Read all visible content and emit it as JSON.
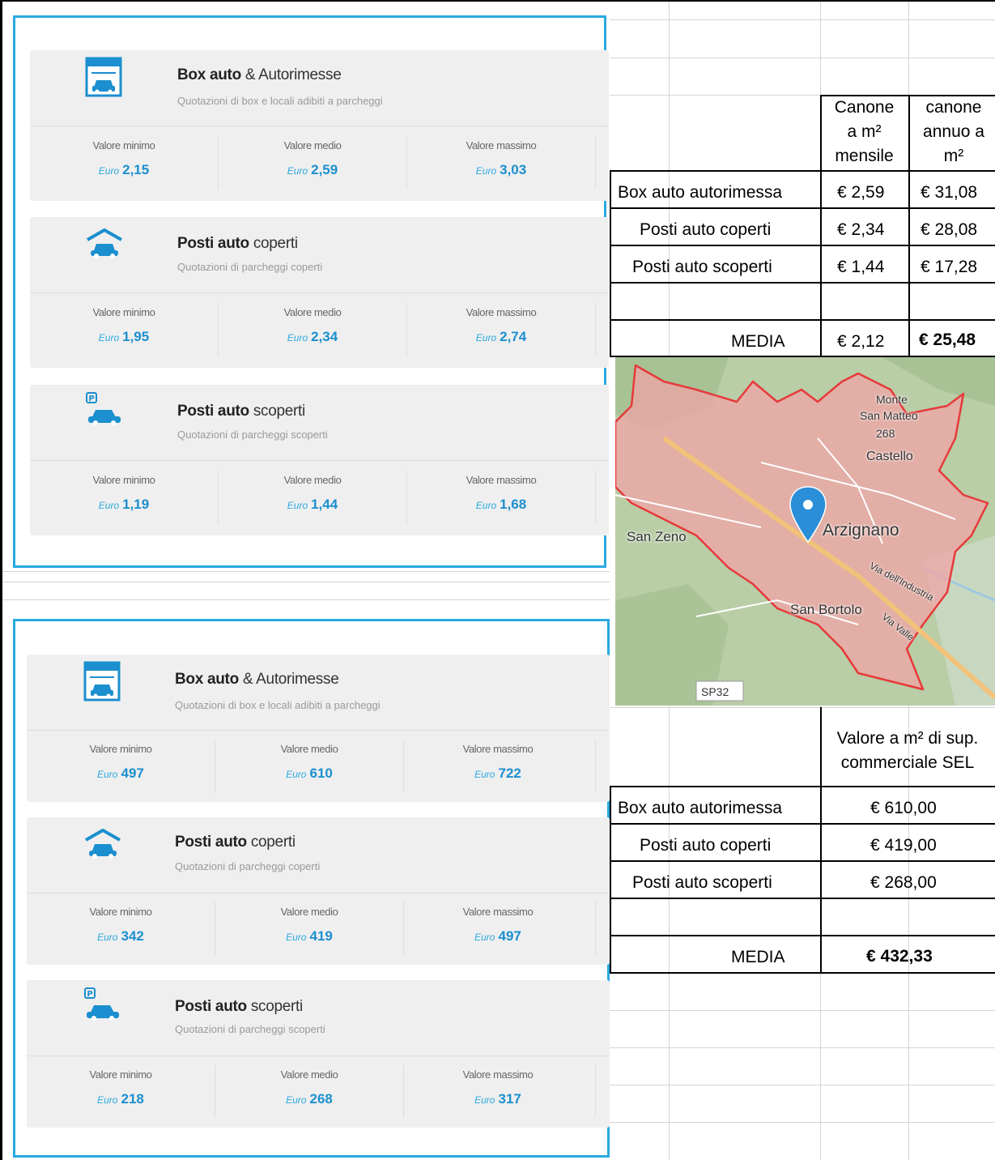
{
  "colors": {
    "accent": "#29a9e0",
    "value_blue": "#1b8fcf"
  },
  "panels": [
    {
      "cards": [
        {
          "icon": "garage-icon",
          "title_bold": "Box auto",
          "title_rest": " & Autorimesse",
          "subtitle": "Quotazioni di box e locali adibiti a parcheggi",
          "labels": [
            "Valore minimo",
            "Valore medio",
            "Valore massimo"
          ],
          "euro": "Euro",
          "values": [
            "2,15",
            "2,59",
            "3,03"
          ]
        },
        {
          "icon": "covered-parking-icon",
          "title_bold": "Posti auto",
          "title_rest": " coperti",
          "subtitle": "Quotazioni di parcheggi coperti",
          "labels": [
            "Valore minimo",
            "Valore medio",
            "Valore massimo"
          ],
          "euro": "Euro",
          "values": [
            "1,95",
            "2,34",
            "2,74"
          ]
        },
        {
          "icon": "open-parking-icon",
          "title_bold": "Posti auto",
          "title_rest": " scoperti",
          "subtitle": "Quotazioni di parcheggi scoperti",
          "labels": [
            "Valore minimo",
            "Valore medio",
            "Valore massimo"
          ],
          "euro": "Euro",
          "values": [
            "1,19",
            "1,44",
            "1,68"
          ]
        }
      ]
    },
    {
      "cards": [
        {
          "icon": "garage-icon",
          "title_bold": "Box auto",
          "title_rest": " & Autorimesse",
          "subtitle": "Quotazioni di box e locali adibiti a parcheggi",
          "labels": [
            "Valore minimo",
            "Valore medio",
            "Valore massimo"
          ],
          "euro": "Euro",
          "values": [
            "497",
            "610",
            "722"
          ]
        },
        {
          "icon": "covered-parking-icon",
          "title_bold": "Posti auto",
          "title_rest": " coperti",
          "subtitle": "Quotazioni di parcheggi coperti",
          "labels": [
            "Valore minimo",
            "Valore medio",
            "Valore massimo"
          ],
          "euro": "Euro",
          "values": [
            "342",
            "419",
            "497"
          ]
        },
        {
          "icon": "open-parking-icon",
          "title_bold": "Posti auto",
          "title_rest": " scoperti",
          "subtitle": "Quotazioni di parcheggi scoperti",
          "labels": [
            "Valore minimo",
            "Valore medio",
            "Valore massimo"
          ],
          "euro": "Euro",
          "values": [
            "218",
            "268",
            "317"
          ]
        }
      ]
    }
  ],
  "rent_table": {
    "header_col1": [
      "Canone",
      "a m²",
      "mensile"
    ],
    "header_col2": [
      "canone",
      "annuo a",
      "m²"
    ],
    "rows": [
      {
        "label": "Box auto autorimessa",
        "monthly": "€ 2,59",
        "yearly": "€ 31,08"
      },
      {
        "label": "Posti auto coperti",
        "monthly": "€ 2,34",
        "yearly": "€ 28,08"
      },
      {
        "label": "Posti auto scoperti",
        "monthly": "€ 1,44",
        "yearly": "€ 17,28"
      }
    ],
    "media_label": "MEDIA",
    "media_monthly": "€ 2,12",
    "media_yearly": "€ 25,48"
  },
  "map": {
    "labels": {
      "monte": "Monte",
      "san_matteo": "San Matteo",
      "elev": "268",
      "castello": "Castello",
      "city": "Arzignano",
      "san_zeno": "San Zeno",
      "san_bortolo": "San Bortolo",
      "via_industria": "Via dell'Industria",
      "via_valle": "Via Valle",
      "sp32": "SP32"
    },
    "pin_icon": "map-pin-icon"
  },
  "value_table": {
    "header": [
      "Valore a m² di sup.",
      "commerciale SEL"
    ],
    "rows": [
      {
        "label": "Box auto autorimessa",
        "value": "€ 610,00"
      },
      {
        "label": "Posti auto coperti",
        "value": "€ 419,00"
      },
      {
        "label": "Posti auto scoperti",
        "value": "€ 268,00"
      }
    ],
    "media_label": "MEDIA",
    "media_value": "€ 432,33"
  }
}
